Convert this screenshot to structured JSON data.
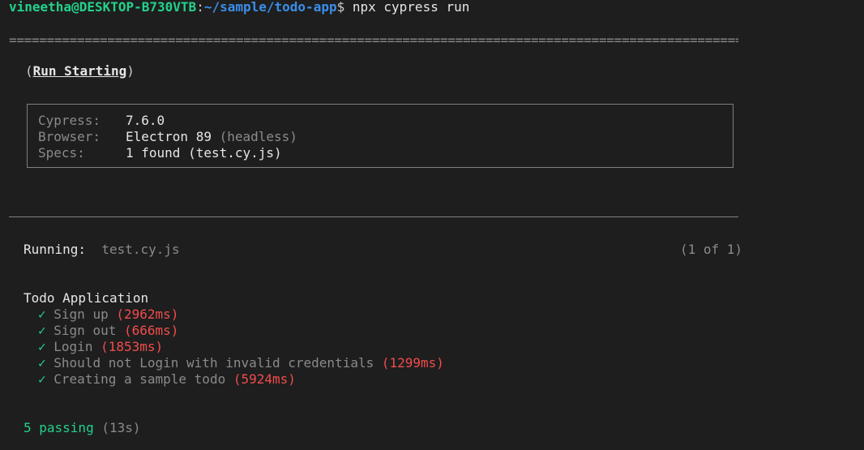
{
  "prompt": {
    "user_host": "vineetha@DESKTOP-B730VTB",
    "colon": ":",
    "path": "~/sample/todo-app",
    "dollar": "$",
    "command": " npx cypress run"
  },
  "separator": "====================================================================================================",
  "run_starting": {
    "open": "(",
    "title": "Run Starting",
    "close": ")"
  },
  "info": {
    "cypress_label": "Cypress:",
    "cypress_value": "7.6.0",
    "browser_label": "Browser:",
    "browser_value": "Electron 89",
    "browser_mode": "(headless)",
    "specs_label": "Specs:",
    "specs_value": "1 found (test.cy.js)"
  },
  "running": {
    "label": "Running:",
    "spec": "test.cy.js",
    "count": "(1 of 1)"
  },
  "suite": {
    "title": "Todo Application",
    "tests": [
      {
        "check": "✓",
        "name": "Sign up",
        "duration": "(2962ms)"
      },
      {
        "check": "✓",
        "name": "Sign out",
        "duration": "(666ms)"
      },
      {
        "check": "✓",
        "name": "Login",
        "duration": "(1853ms)"
      },
      {
        "check": "✓",
        "name": "Should not Login with invalid credentials",
        "duration": "(1299ms)"
      },
      {
        "check": "✓",
        "name": "Creating a sample todo",
        "duration": "(5924ms)"
      }
    ]
  },
  "summary": {
    "passing": "5 passing",
    "time": "(13s)"
  },
  "colors": {
    "background": "#1e1e1e",
    "green": "#23d18b",
    "blue": "#3b8eea",
    "red": "#f14c4c"
  }
}
